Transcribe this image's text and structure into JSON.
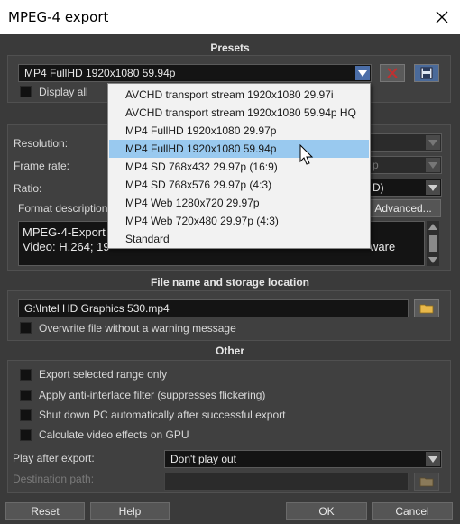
{
  "window": {
    "title": "MPEG-4 export"
  },
  "presets": {
    "heading": "Presets",
    "selected": "MP4 FullHD 1920x1080 59.94p",
    "display_all_label": "Display all",
    "options": [
      "AVCHD transport stream 1920x1080 29.97i",
      "AVCHD transport stream 1920x1080 59.94p HQ",
      "MP4 FullHD 1920x1080 29.97p",
      "MP4 FullHD 1920x1080 59.94p",
      "MP4 SD 768x432 29.97p (16:9)",
      "MP4 SD 768x576 29.97p (4:3)",
      "MP4 Web 1280x720 29.97p",
      "MP4 Web 720x480 29.97p (4:3)",
      "Standard"
    ],
    "highlighted_index": 3
  },
  "settings": {
    "resolution_label": "Resolution:",
    "frame_rate_label": "Frame rate:",
    "ratio_label": "Ratio:",
    "frame_rate_value_partial": "p",
    "ratio_value_partial": "D)",
    "format_description_label": "Format description",
    "advanced_button": "Advanced...",
    "description_line1": "MPEG-4-Export",
    "description_line2": "Video: H.264; 19",
    "description_line2_tail": "ware"
  },
  "file": {
    "heading": "File name and storage location",
    "path": "G:\\Intel HD Graphics 530.mp4",
    "overwrite_label": "Overwrite file without a warning message"
  },
  "other": {
    "heading": "Other",
    "export_range_label": "Export selected range only",
    "anti_interlace_label": "Apply anti-interlace filter (suppresses flickering)",
    "shutdown_label": "Shut down PC automatically after successful export",
    "gpu_label": "Calculate video effects on GPU",
    "play_after_label": "Play after export:",
    "play_after_value": "Don't play out",
    "destination_label": "Destination path:"
  },
  "footer": {
    "reset": "Reset",
    "help": "Help",
    "ok": "OK",
    "cancel": "Cancel"
  },
  "icons": [
    "close-icon",
    "delete-preset-icon",
    "save-preset-icon",
    "folder-icon",
    "chevron-down-icon",
    "mouse-cursor-icon"
  ],
  "colors": {
    "highlight": "#99c9ef",
    "arrow_blue": "#4b6ea8",
    "delete_red": "#c03030"
  }
}
